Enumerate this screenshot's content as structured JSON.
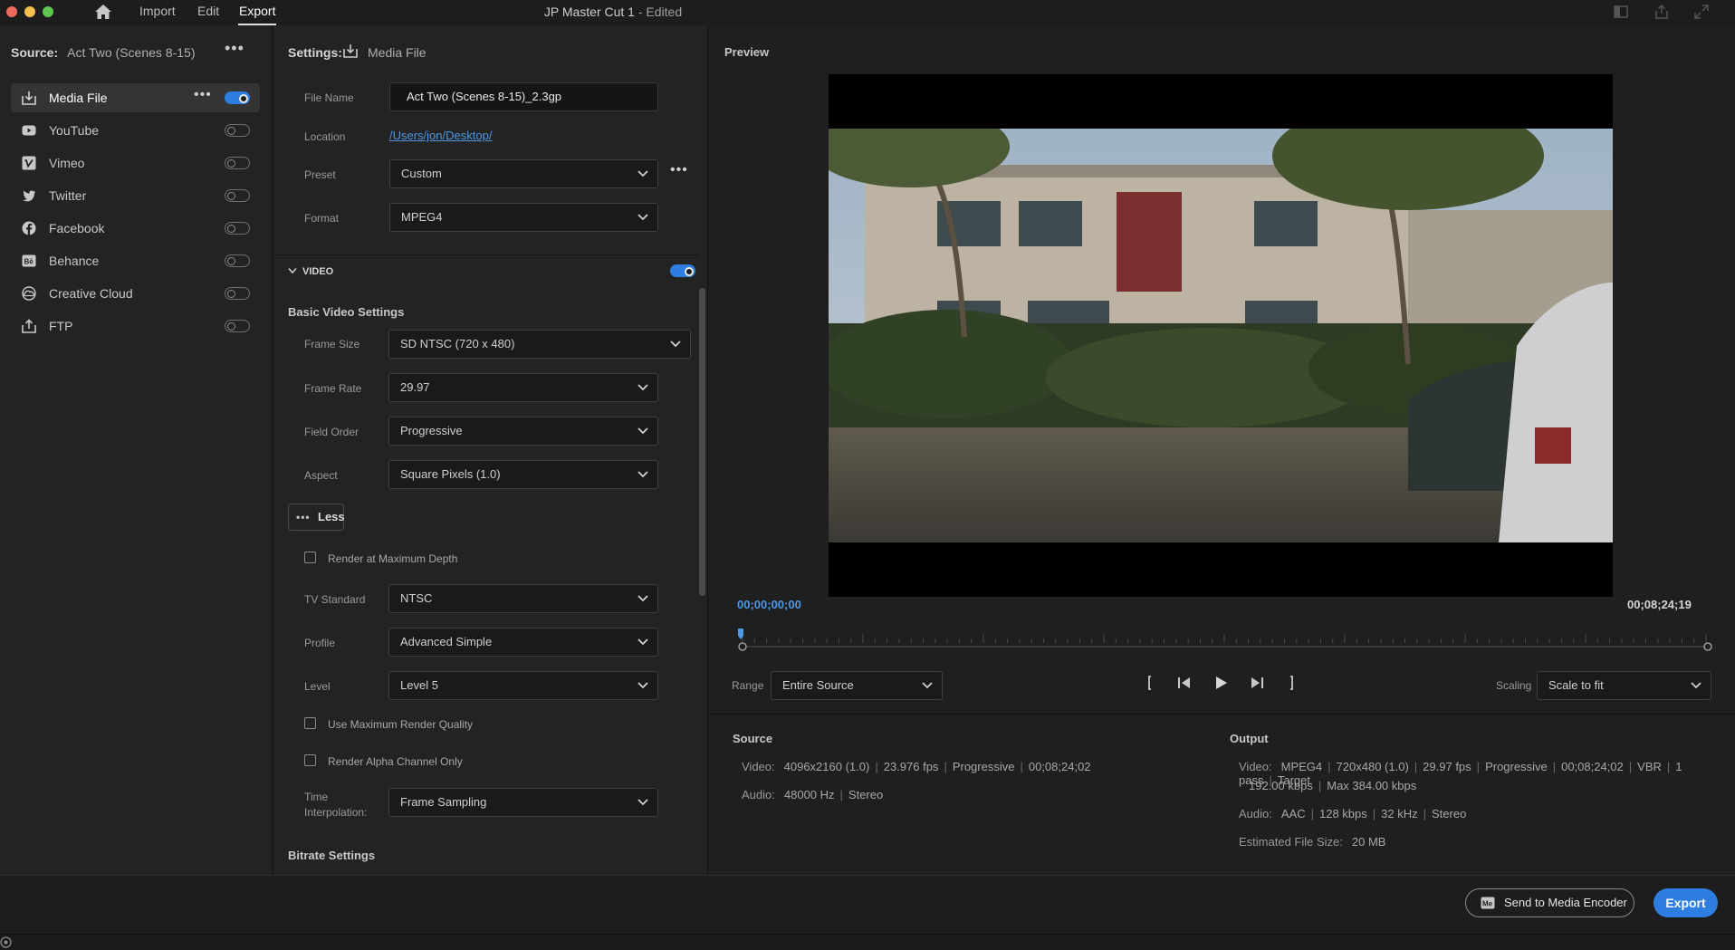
{
  "titlebar": {
    "menu": [
      "Import",
      "Edit",
      "Export"
    ],
    "active_menu": "Export",
    "title": "JP Master Cut 1",
    "title_suffix": " - Edited"
  },
  "source": {
    "label": "Source:",
    "value": "Act Two (Scenes 8-15)"
  },
  "destinations": [
    {
      "label": "Media File",
      "icon": "media-file-icon",
      "on": true
    },
    {
      "label": "YouTube",
      "icon": "youtube-icon",
      "on": false
    },
    {
      "label": "Vimeo",
      "icon": "vimeo-icon",
      "on": false
    },
    {
      "label": "Twitter",
      "icon": "twitter-icon",
      "on": false
    },
    {
      "label": "Facebook",
      "icon": "facebook-icon",
      "on": false
    },
    {
      "label": "Behance",
      "icon": "behance-icon",
      "on": false
    },
    {
      "label": "Creative Cloud",
      "icon": "creative-cloud-icon",
      "on": false
    },
    {
      "label": "FTP",
      "icon": "ftp-icon",
      "on": false
    }
  ],
  "settings": {
    "label": "Settings:",
    "value": "Media File",
    "file_name_label": "File Name",
    "file_name": "Act Two (Scenes 8-15)_2.3gp",
    "location_label": "Location",
    "location": "/Users/jon/Desktop/",
    "preset_label": "Preset",
    "preset": "Custom",
    "format_label": "Format",
    "format": "MPEG4",
    "video_section": "VIDEO",
    "video_on": true,
    "basic_video": "Basic Video Settings",
    "frame_size_label": "Frame Size",
    "frame_size": "SD NTSC (720 x 480)",
    "frame_rate_label": "Frame Rate",
    "frame_rate": "29.97",
    "field_order_label": "Field Order",
    "field_order": "Progressive",
    "aspect_label": "Aspect",
    "aspect": "Square Pixels (1.0)",
    "less_label": "Less",
    "render_max_depth": "Render at Maximum Depth",
    "tv_standard_label": "TV Standard",
    "tv_standard": "NTSC",
    "profile_label": "Profile",
    "profile": "Advanced Simple",
    "level_label": "Level",
    "level": "Level 5",
    "max_render_quality": "Use Maximum Render Quality",
    "render_alpha": "Render Alpha Channel Only",
    "time_interp_label_1": "Time",
    "time_interp_label_2": "Interpolation:",
    "time_interp": "Frame Sampling",
    "bitrate": "Bitrate Settings"
  },
  "preview": {
    "title": "Preview",
    "tc_start": "00;00;00;00",
    "tc_end": "00;08;24;19",
    "range_label": "Range",
    "range": "Entire Source",
    "scaling_label": "Scaling",
    "scaling": "Scale to fit"
  },
  "source_info": {
    "heading": "Source",
    "video_label": "Video:",
    "video": [
      "4096x2160 (1.0)",
      "23.976 fps",
      "Progressive",
      "00;08;24;02"
    ],
    "audio_label": "Audio:",
    "audio": [
      "48000 Hz",
      "Stereo"
    ]
  },
  "output_info": {
    "heading": "Output",
    "video_label": "Video:",
    "video_line1": [
      "MPEG4",
      "720x480 (1.0)",
      "29.97 fps",
      "Progressive",
      "00;08;24;02",
      "VBR",
      "1 pass",
      "Target"
    ],
    "video_line2": [
      "192.00 kbps",
      "Max 384.00 kbps"
    ],
    "audio_label": "Audio:",
    "audio": [
      "AAC",
      "128 kbps",
      "32 kHz",
      "Stereo"
    ],
    "size_label": "Estimated File Size:",
    "size": "20 MB"
  },
  "footer": {
    "send_label": "Send to Media Encoder",
    "export_label": "Export"
  },
  "colors": {
    "accent": "#2d7ee0",
    "link": "#4d98e8",
    "background": "#1d1d1d"
  }
}
